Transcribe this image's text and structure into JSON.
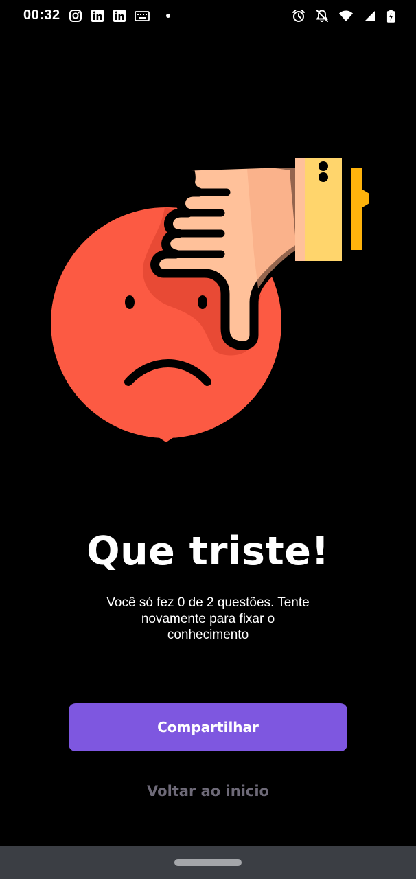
{
  "status_bar": {
    "time": "00:32",
    "left_icons": [
      "instagram-icon",
      "linkedin-icon",
      "linkedin-icon",
      "keyboard-icon",
      "dot-icon"
    ],
    "right_icons": [
      "alarm-icon",
      "notifications-off-icon",
      "wifi-icon",
      "signal-icon",
      "battery-charging-icon"
    ]
  },
  "illustration": {
    "icon": "sad-face-thumbs-down-icon",
    "colors": {
      "face": "#fc5a43",
      "hand": "#ffc19a",
      "cuff": "#ffd56c",
      "cuff_accent": "#ffb30c",
      "outline": "#000000"
    }
  },
  "result": {
    "title": "Que triste!",
    "message": "Você só fez 0 de 2 questões. Tente novamente para fixar o conhecimento"
  },
  "actions": {
    "share_label": "Compartilhar",
    "back_label": "Voltar ao inicio"
  },
  "colors": {
    "background": "#000000",
    "primary": "#7e57e0",
    "secondary_text": "#6e6a78",
    "nav_bar": "#3b3e44"
  }
}
